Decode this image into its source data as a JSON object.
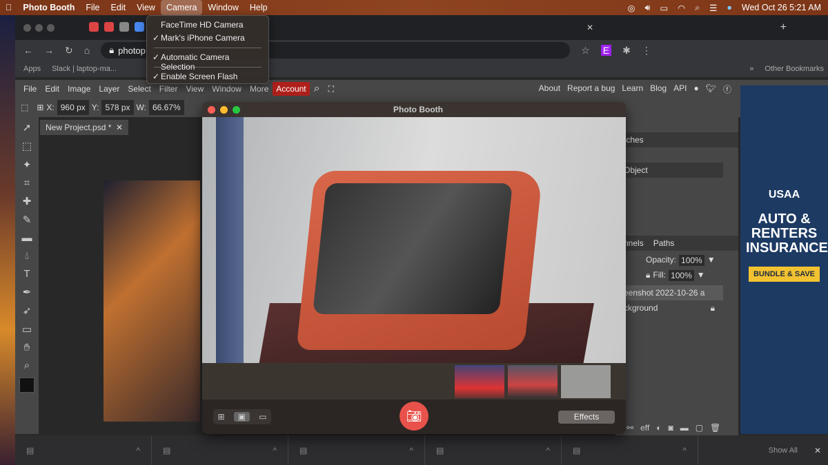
{
  "menubar": {
    "app": "Photo Booth",
    "items": [
      "File",
      "Edit",
      "View",
      "Camera",
      "Window",
      "Help"
    ],
    "datetime": "Wed Oct 26  5:21 AM"
  },
  "camera_menu": {
    "items": [
      {
        "label": "FaceTime HD Camera",
        "checked": false
      },
      {
        "label": "Mark's iPhone Camera",
        "checked": true
      },
      {
        "label": "Automatic Camera Selection",
        "checked": true
      },
      {
        "label": "Enable Screen Flash",
        "checked": true
      }
    ],
    "check": "✓"
  },
  "browser": {
    "url": "photop",
    "bookmarks": {
      "apps": "Apps",
      "slack": "Slack | laptop-ma...",
      "other": "Other Bookmarks",
      "more": "»"
    }
  },
  "photopea": {
    "menu": [
      "File",
      "Edit",
      "Image",
      "Layer",
      "Select",
      "Filter",
      "View",
      "Window",
      "More"
    ],
    "account": "Account",
    "links": [
      "About",
      "Report a bug",
      "Learn",
      "Blog",
      "API"
    ],
    "options": {
      "x_label": "X:",
      "x": "960 px",
      "y_label": "Y:",
      "y": "578 px",
      "w_label": "W:",
      "w": "66.67%"
    },
    "doc_tab": "New Project.psd *",
    "panels": {
      "swatches": "tches",
      "object": "Object",
      "channels": "nnels",
      "paths": "Paths",
      "opacity_label": "Opacity:",
      "opacity": "100%",
      "fill_label": "Fill:",
      "fill": "100%",
      "layers": [
        "eenshot 2022-10-26 a",
        "ckground"
      ]
    }
  },
  "ad": {
    "brand": "USAA",
    "headline": "AUTO & RENTERS INSURANCE",
    "cta": "BUNDLE & SAVE",
    "colors": {
      "bg": "#1d3a63",
      "cta": "#f2c230"
    }
  },
  "photobooth": {
    "title": "Photo Booth",
    "effects": "Effects",
    "shutter_color": "#e8524a"
  },
  "downloads": {
    "show_all": "Show All",
    "close": "✕"
  }
}
